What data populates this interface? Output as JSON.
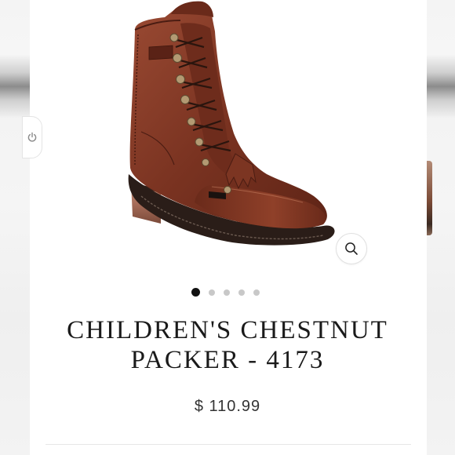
{
  "product": {
    "title_line1": "CHILDREN'S CHESTNUT",
    "title_line2": "PACKER - 4173",
    "price": "$ 110.99"
  },
  "gallery": {
    "image_count": 5,
    "active_index": 0
  },
  "icons": {
    "power": "power-icon",
    "zoom": "magnifier-icon"
  },
  "colors": {
    "boot_leather": "#7a3321",
    "active_dot": "#111111",
    "inactive_dot": "#c8c8c8"
  }
}
